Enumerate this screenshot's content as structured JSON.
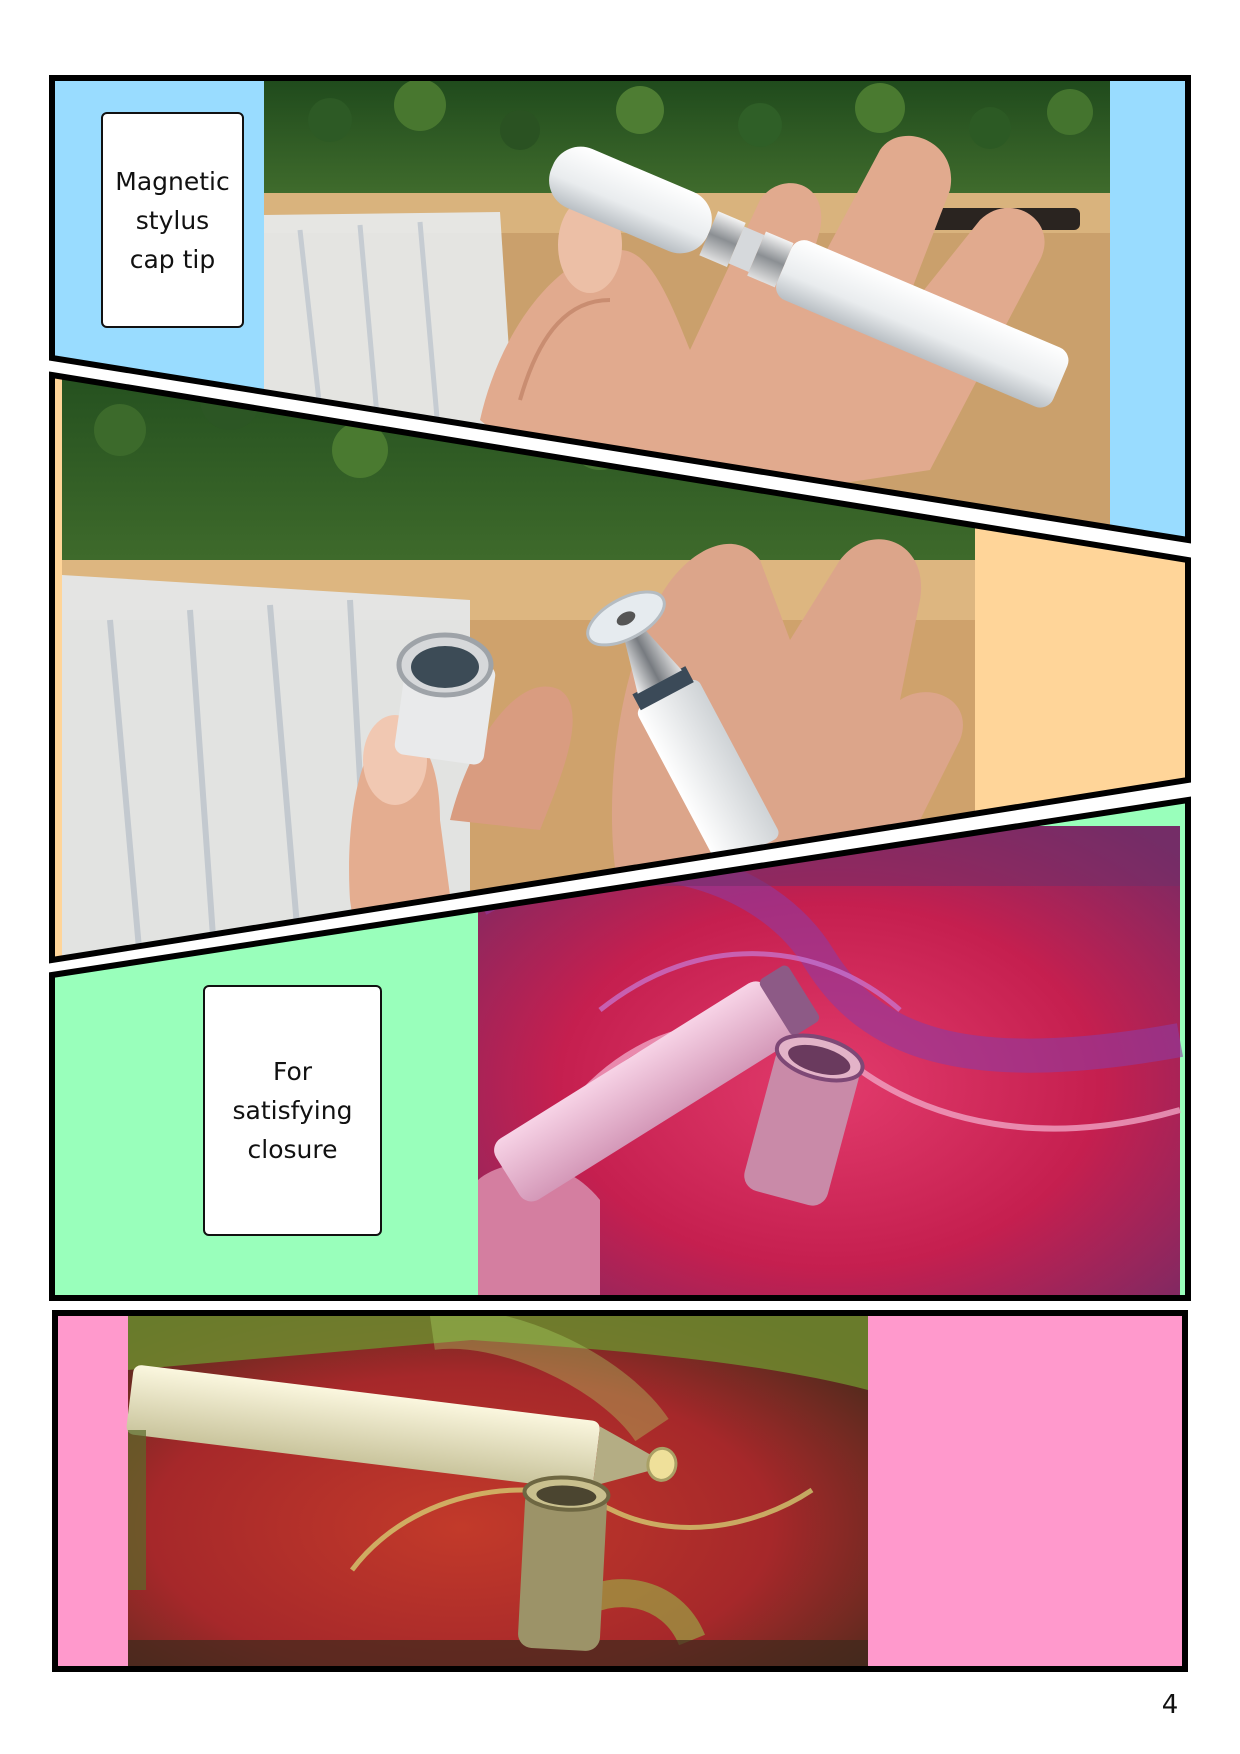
{
  "panels": [
    {
      "caption": "Magnetic\nstylus\ncap tip",
      "background_color": "#99dcff",
      "photo": "hand holding white magnetic stylus with chrome tip"
    },
    {
      "caption": "",
      "background_color": "#ffd599",
      "photo": "hand holding white stylus with removed cap and disc tip"
    },
    {
      "caption": "For\nsatisfying\nclosure",
      "background_color": "#99ffbb",
      "photo": "pink stylus and cap over colorful mat"
    },
    {
      "caption": "",
      "background_color": "#ff99cc",
      "photo": "stylus with disc tip and cap on red and green mat"
    }
  ],
  "page_number": "4"
}
